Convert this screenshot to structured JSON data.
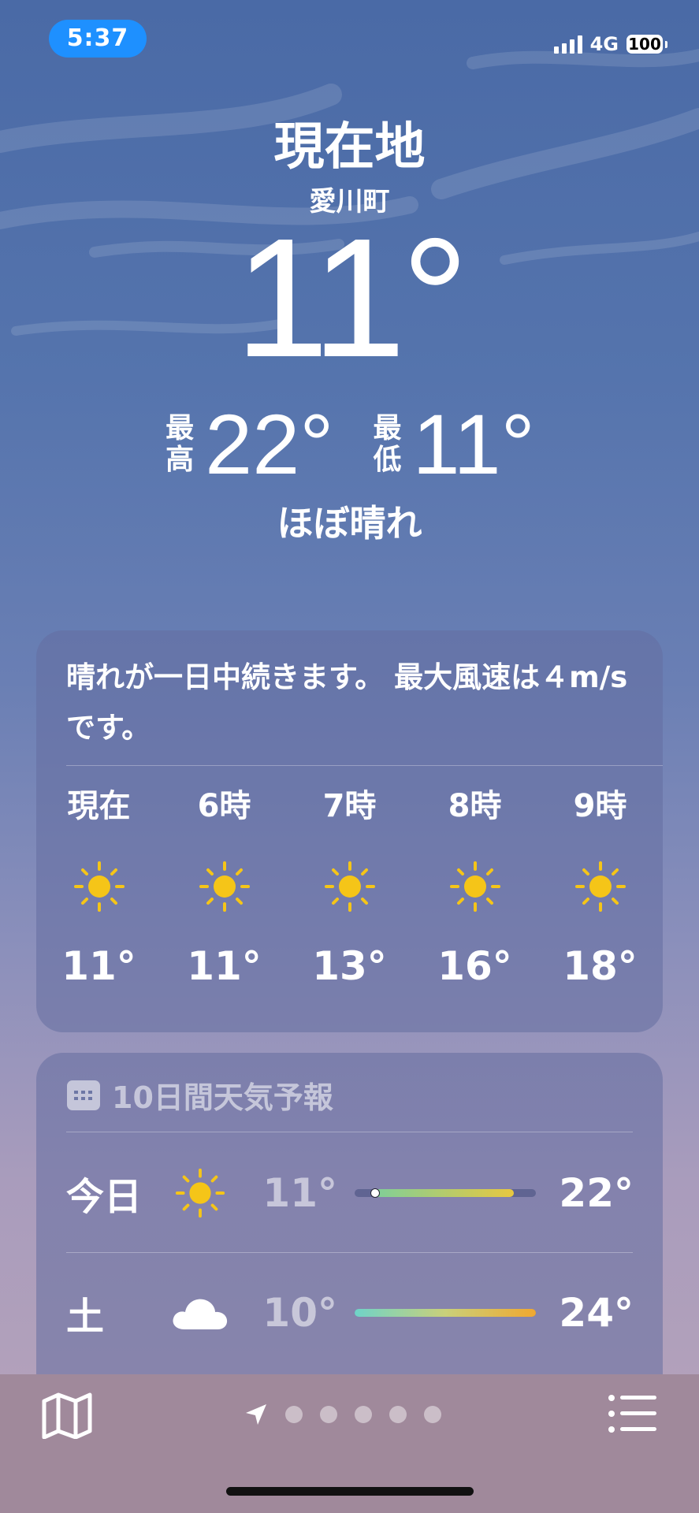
{
  "status": {
    "time": "5:37",
    "network": "4G",
    "battery": "100"
  },
  "header": {
    "location": "現在地",
    "city": "愛川町",
    "temperature": "11°",
    "high_label": "最\n高",
    "high": "22°",
    "low_label": "最\n低",
    "low": "11°",
    "condition": "ほぼ晴れ"
  },
  "hourly_card": {
    "summary": "晴れが一日中続きます。 最大風速は４m/sです。",
    "hours": [
      {
        "label": "現在",
        "icon": "sun-icon",
        "temp": "11°"
      },
      {
        "label": "6時",
        "icon": "sun-icon",
        "temp": "11°"
      },
      {
        "label": "7時",
        "icon": "sun-icon",
        "temp": "13°"
      },
      {
        "label": "8時",
        "icon": "sun-icon",
        "temp": "16°"
      },
      {
        "label": "9時",
        "icon": "sun-icon",
        "temp": "18°"
      }
    ]
  },
  "forecast": {
    "title": "10日間天気予報",
    "days": [
      {
        "day": "今日",
        "icon": "sun-icon",
        "low": "11°",
        "high": "22°"
      },
      {
        "day": "土",
        "icon": "cloud-icon",
        "low": "10°",
        "high": "24°"
      }
    ]
  },
  "colors": {
    "sun": "#f5c518",
    "bar_today": "#e8c840",
    "bar_sat": "#f0a830",
    "accent": "#1e90ff"
  }
}
